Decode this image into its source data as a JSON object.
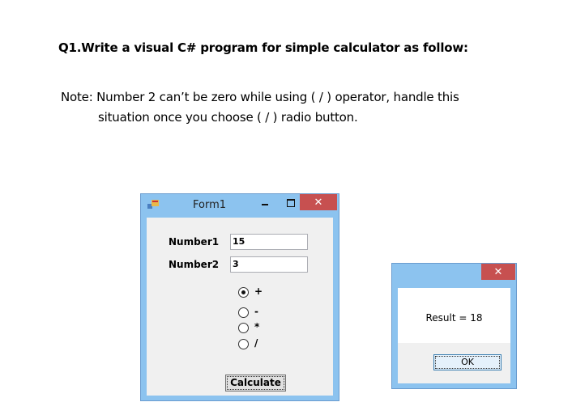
{
  "question": {
    "title": "Q1.Write a visual C# program for simple calculator as follow:",
    "note_line1": "Note: Number 2 can’t be zero while using ( / ) operator, handle this",
    "note_line2": "situation once you choose ( / ) radio button."
  },
  "form": {
    "title": "Form1",
    "close_glyph": "✕",
    "number1_label": "Number1",
    "number1_value": "15",
    "number2_label": "Number2",
    "number2_value": "3",
    "operators": [
      {
        "label": "+",
        "selected": true
      },
      {
        "label": "-",
        "selected": false
      },
      {
        "label": "*",
        "selected": false
      },
      {
        "label": "/",
        "selected": false
      }
    ],
    "calculate_label": "Calculate"
  },
  "message_box": {
    "close_glyph": "✕",
    "text": "Result = 18",
    "ok_label": "OK"
  }
}
